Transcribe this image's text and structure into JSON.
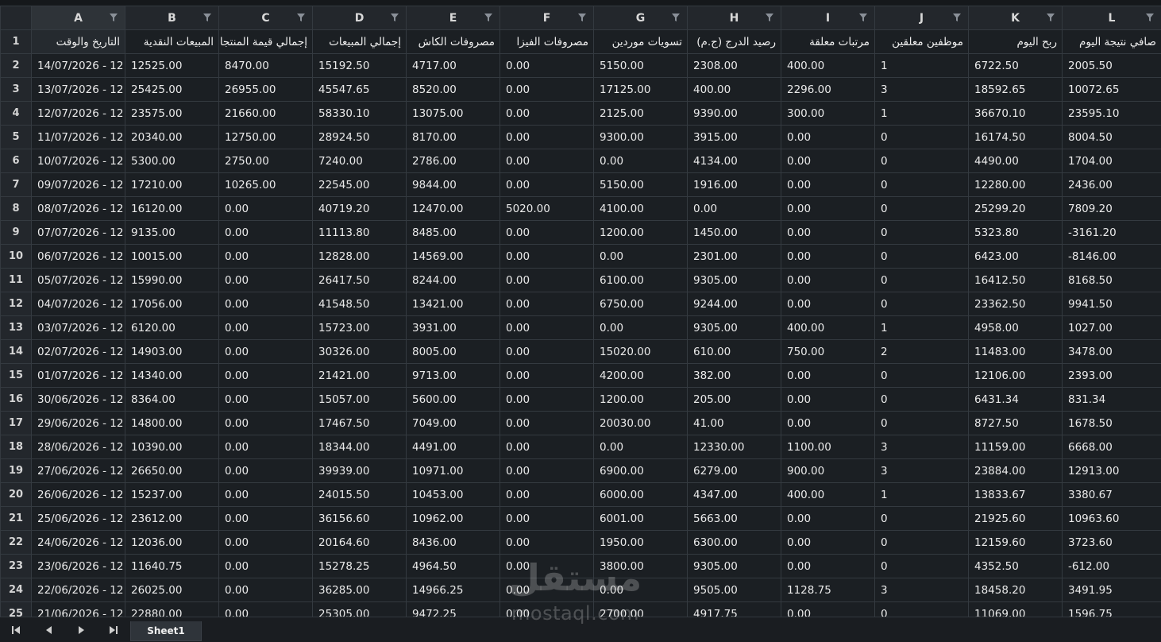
{
  "sheet": {
    "columns": [
      "A",
      "B",
      "C",
      "D",
      "E",
      "F",
      "G",
      "H",
      "I",
      "J",
      "K",
      "L"
    ],
    "selected_column": "A",
    "header_row_number": "1",
    "headers": [
      "التاريخ والوقت",
      "المبيعات النقدية",
      "إجمالي قيمة المنتجات",
      "إجمالي المبيعات",
      "مصروفات الكاش",
      "مصروفات الفيزا",
      "تسويات موردين",
      "رصيد الدرج (ج.م)",
      "مرتبات معلقة",
      "موظفين معلقين",
      "ربح اليوم",
      "صافي نتيجة اليوم"
    ],
    "rows": [
      {
        "n": "2",
        "c": [
          "14/07/2026 - 12",
          "12525.00",
          "8470.00",
          "15192.50",
          "4717.00",
          "0.00",
          "5150.00",
          "2308.00",
          "400.00",
          "1",
          "6722.50",
          "2005.50"
        ]
      },
      {
        "n": "3",
        "c": [
          "13/07/2026 - 12",
          "25425.00",
          "26955.00",
          "45547.65",
          "8520.00",
          "0.00",
          "17125.00",
          "400.00",
          "2296.00",
          "3",
          "18592.65",
          "10072.65"
        ]
      },
      {
        "n": "4",
        "c": [
          "12/07/2026 - 12",
          "23575.00",
          "21660.00",
          "58330.10",
          "13075.00",
          "0.00",
          "2125.00",
          "9390.00",
          "300.00",
          "1",
          "36670.10",
          "23595.10"
        ]
      },
      {
        "n": "5",
        "c": [
          "11/07/2026 - 12",
          "20340.00",
          "12750.00",
          "28924.50",
          "8170.00",
          "0.00",
          "9300.00",
          "3915.00",
          "0.00",
          "0",
          "16174.50",
          "8004.50"
        ]
      },
      {
        "n": "6",
        "c": [
          "10/07/2026 - 12",
          "5300.00",
          "2750.00",
          "7240.00",
          "2786.00",
          "0.00",
          "0.00",
          "4134.00",
          "0.00",
          "0",
          "4490.00",
          "1704.00"
        ]
      },
      {
        "n": "7",
        "c": [
          "09/07/2026 - 12",
          "17210.00",
          "10265.00",
          "22545.00",
          "9844.00",
          "0.00",
          "5150.00",
          "1916.00",
          "0.00",
          "0",
          "12280.00",
          "2436.00"
        ]
      },
      {
        "n": "8",
        "c": [
          "08/07/2026 - 12",
          "16120.00",
          "0.00",
          "40719.20",
          "12470.00",
          "5020.00",
          "4100.00",
          "0.00",
          "0.00",
          "0",
          "25299.20",
          "7809.20"
        ]
      },
      {
        "n": "9",
        "c": [
          "07/07/2026 - 12",
          "9135.00",
          "0.00",
          "11113.80",
          "8485.00",
          "0.00",
          "1200.00",
          "1450.00",
          "0.00",
          "0",
          "5323.80",
          "-3161.20"
        ]
      },
      {
        "n": "10",
        "c": [
          "06/07/2026 - 12",
          "10015.00",
          "0.00",
          "12828.00",
          "14569.00",
          "0.00",
          "0.00",
          "2301.00",
          "0.00",
          "0",
          "6423.00",
          "-8146.00"
        ]
      },
      {
        "n": "11",
        "c": [
          "05/07/2026 - 12",
          "15990.00",
          "0.00",
          "26417.50",
          "8244.00",
          "0.00",
          "6100.00",
          "9305.00",
          "0.00",
          "0",
          "16412.50",
          "8168.50"
        ]
      },
      {
        "n": "12",
        "c": [
          "04/07/2026 - 12",
          "17056.00",
          "0.00",
          "41548.50",
          "13421.00",
          "0.00",
          "6750.00",
          "9244.00",
          "0.00",
          "0",
          "23362.50",
          "9941.50"
        ]
      },
      {
        "n": "13",
        "c": [
          "03/07/2026 - 12",
          "6120.00",
          "0.00",
          "15723.00",
          "3931.00",
          "0.00",
          "0.00",
          "9305.00",
          "400.00",
          "1",
          "4958.00",
          "1027.00"
        ]
      },
      {
        "n": "14",
        "c": [
          "02/07/2026 - 12",
          "14903.00",
          "0.00",
          "30326.00",
          "8005.00",
          "0.00",
          "15020.00",
          "610.00",
          "750.00",
          "2",
          "11483.00",
          "3478.00"
        ]
      },
      {
        "n": "15",
        "c": [
          "01/07/2026 - 12",
          "14340.00",
          "0.00",
          "21421.00",
          "9713.00",
          "0.00",
          "4200.00",
          "382.00",
          "0.00",
          "0",
          "12106.00",
          "2393.00"
        ]
      },
      {
        "n": "16",
        "c": [
          "30/06/2026 - 12",
          "8364.00",
          "0.00",
          "15057.00",
          "5600.00",
          "0.00",
          "1200.00",
          "205.00",
          "0.00",
          "0",
          "6431.34",
          "831.34"
        ]
      },
      {
        "n": "17",
        "c": [
          "29/06/2026 - 12",
          "14800.00",
          "0.00",
          "17467.50",
          "7049.00",
          "0.00",
          "20030.00",
          "41.00",
          "0.00",
          "0",
          "8727.50",
          "1678.50"
        ]
      },
      {
        "n": "18",
        "c": [
          "28/06/2026 - 12",
          "10390.00",
          "0.00",
          "18344.00",
          "4491.00",
          "0.00",
          "0.00",
          "12330.00",
          "1100.00",
          "3",
          "11159.00",
          "6668.00"
        ]
      },
      {
        "n": "19",
        "c": [
          "27/06/2026 - 12",
          "26650.00",
          "0.00",
          "39939.00",
          "10971.00",
          "0.00",
          "6900.00",
          "6279.00",
          "900.00",
          "3",
          "23884.00",
          "12913.00"
        ]
      },
      {
        "n": "20",
        "c": [
          "26/06/2026 - 12",
          "15237.00",
          "0.00",
          "24015.50",
          "10453.00",
          "0.00",
          "6000.00",
          "4347.00",
          "400.00",
          "1",
          "13833.67",
          "3380.67"
        ]
      },
      {
        "n": "21",
        "c": [
          "25/06/2026 - 12",
          "23612.00",
          "0.00",
          "36156.60",
          "10962.00",
          "0.00",
          "6001.00",
          "5663.00",
          "0.00",
          "0",
          "21925.60",
          "10963.60"
        ]
      },
      {
        "n": "22",
        "c": [
          "24/06/2026 - 12",
          "12036.00",
          "0.00",
          "20164.60",
          "8436.00",
          "0.00",
          "1950.00",
          "6300.00",
          "0.00",
          "0",
          "12159.60",
          "3723.60"
        ]
      },
      {
        "n": "23",
        "c": [
          "23/06/2026 - 12",
          "11640.75",
          "0.00",
          "15278.25",
          "4964.50",
          "0.00",
          "3800.00",
          "9305.00",
          "0.00",
          "0",
          "4352.50",
          "-612.00"
        ]
      },
      {
        "n": "24",
        "c": [
          "22/06/2026 - 12",
          "26025.00",
          "0.00",
          "36285.00",
          "14966.25",
          "0.00",
          "0.00",
          "9505.00",
          "1128.75",
          "3",
          "18458.20",
          "3491.95"
        ]
      },
      {
        "n": "25",
        "c": [
          "21/06/2026 - 12",
          "22880.00",
          "0.00",
          "25305.00",
          "9472.25",
          "0.00",
          "2700.00",
          "4917.75",
          "0.00",
          "0",
          "11069.00",
          "1596.75"
        ]
      }
    ]
  },
  "tabs": {
    "active": "Sheet1"
  },
  "watermark": {
    "arabic": "مستقل",
    "latin": "mostaql.com"
  },
  "icons": {
    "filter": "filter-icon",
    "first": "first-sheet-icon",
    "prev": "prev-sheet-icon",
    "next": "next-sheet-icon",
    "last": "last-sheet-icon"
  },
  "colors": {
    "background": "#1b1f23",
    "header": "#23272c",
    "gridline": "#343a40",
    "text": "#eaeaea"
  }
}
